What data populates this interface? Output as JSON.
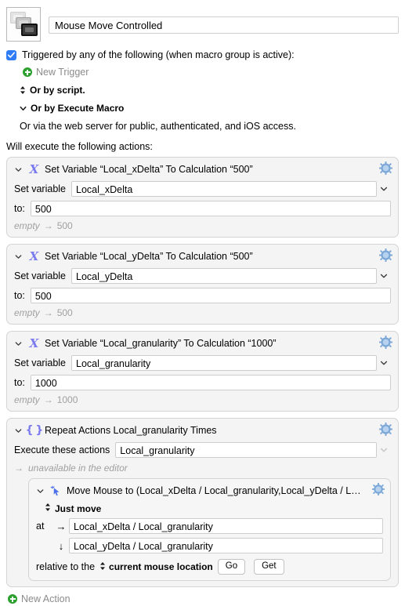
{
  "header": {
    "macro_icon": "cascading-windows-icon",
    "title_value": "Mouse Move Controlled"
  },
  "trigger": {
    "checkbox_checked": true,
    "label": "Triggered by any of the following (when macro group is active):",
    "new_trigger_label": "New Trigger",
    "or_script": "Or by script.",
    "or_execute_macro": "Or by Execute Macro",
    "web_server_note": "Or via the web server for public, authenticated, and iOS access."
  },
  "actions_header": "Will execute the following actions:",
  "new_action_label": "New Action",
  "actions": [
    {
      "icon": "calculation-x-icon",
      "title": "Set Variable “Local_xDelta” To Calculation “500”",
      "variable_label": "Set variable",
      "variable_value": "Local_xDelta",
      "to_label": "to:",
      "to_value": "500",
      "result_from": "empty",
      "result_arrow": "→",
      "result_to": "500"
    },
    {
      "icon": "calculation-x-icon",
      "title": "Set Variable “Local_yDelta” To Calculation “500”",
      "variable_label": "Set variable",
      "variable_value": "Local_yDelta",
      "to_label": "to:",
      "to_value": "500",
      "result_from": "empty",
      "result_arrow": "→",
      "result_to": "500"
    },
    {
      "icon": "calculation-x-icon",
      "title": "Set Variable “Local_granularity” To Calculation “1000”",
      "variable_label": "Set variable",
      "variable_value": "Local_granularity",
      "to_label": "to:",
      "to_value": "1000",
      "result_from": "empty",
      "result_arrow": "→",
      "result_to": "1000"
    }
  ],
  "repeat_action": {
    "icon": "curly-braces-icon",
    "title": "Repeat Actions Local_granularity Times",
    "execute_label": "Execute these actions",
    "execute_value": "Local_granularity",
    "note_arrow": "→",
    "note": "unavailable in the editor",
    "nested": {
      "icon": "mouse-pointer-sparkle-icon",
      "title": "Move Mouse to (Local_xDelta / Local_granularity,Local_yDelta / Lo…",
      "mode": "Just move",
      "at_label": "at",
      "x_arrow": "→",
      "x_value": "Local_xDelta / Local_granularity",
      "y_arrow": "↓",
      "y_value": "Local_yDelta / Local_granularity",
      "relative_label": "relative to the",
      "relative_value": "current mouse location",
      "go_label": "Go",
      "get_label": "Get"
    }
  },
  "colors": {
    "accent_blue": "#2f7cf6",
    "action_icon_purple": "#7b7bf0",
    "gear_blue": "#9fc2e8",
    "add_green": "#2ca02c",
    "panel_bg": "#f4f4f4",
    "muted_text": "#a0a0a0"
  }
}
